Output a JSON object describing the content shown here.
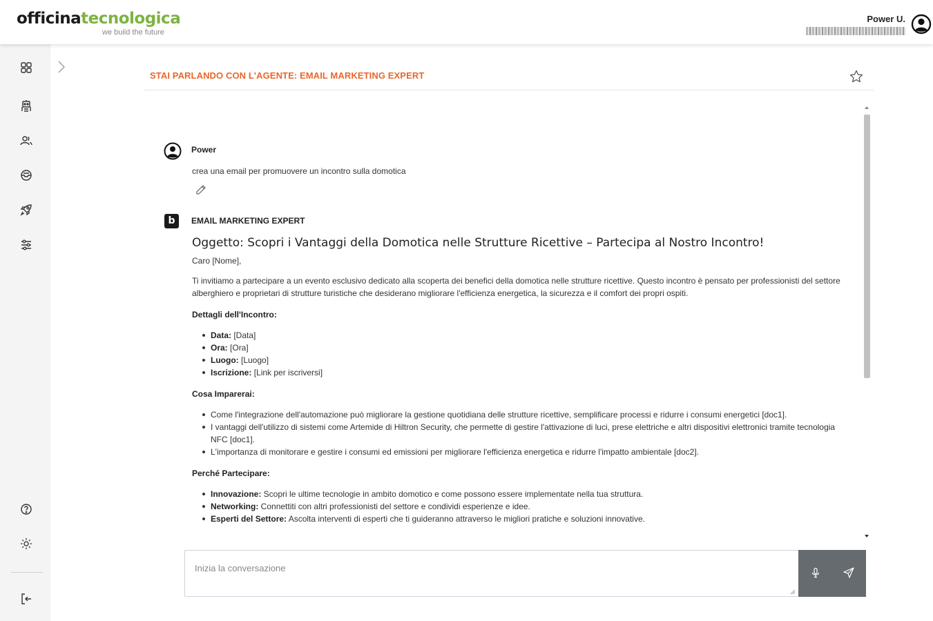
{
  "header": {
    "logo_part1": "offici",
    "logo_part2": "na",
    "logo_part3": "tecnologica",
    "tagline": "we build the future",
    "user_name": "Power U."
  },
  "sidebar": {
    "items": [
      {
        "icon": "dashboard-grid-icon"
      },
      {
        "icon": "robot-icon"
      },
      {
        "icon": "users-icon"
      },
      {
        "icon": "inbox-icon"
      },
      {
        "icon": "rocket-icon"
      },
      {
        "icon": "filters-icon"
      },
      {
        "icon": "help-icon"
      },
      {
        "icon": "brightness-icon"
      },
      {
        "icon": "logout-icon"
      }
    ]
  },
  "agent": {
    "title": "STAI PARLANDO CON L'AGENTE: EMAIL MARKETING EXPERT"
  },
  "chat": {
    "user": {
      "name": "Power",
      "text": "crea una email per promuovere un incontro sulla domotica"
    },
    "bot": {
      "icon_letter": "b",
      "name": "EMAIL MARKETING EXPERT",
      "subject": "Oggetto: Scopri i Vantaggi della Domotica nelle Strutture Ricettive – Partecipa al Nostro Incontro!",
      "greeting": "Caro [Nome],",
      "intro": "Ti invitiamo a partecipare a un evento esclusivo dedicato alla scoperta dei benefici della domotica nelle strutture ricettive. Questo incontro è pensato per professionisti del settore alberghiero e proprietari di strutture turistiche che desiderano migliorare l'efficienza energetica, la sicurezza e il comfort dei propri ospiti.",
      "details_heading": "Dettagli dell'Incontro:",
      "details": [
        {
          "label": "Data:",
          "value": " [Data]"
        },
        {
          "label": "Ora:",
          "value": " [Ora]"
        },
        {
          "label": "Luogo:",
          "value": " [Luogo]"
        },
        {
          "label": "Iscrizione:",
          "value": " [Link per iscriversi]"
        }
      ],
      "learn_heading": "Cosa Imparerai:",
      "learn": [
        "Come l'integrazione dell'automazione può migliorare la gestione quotidiana delle strutture ricettive, semplificare processi e ridurre i consumi energetici [doc1].",
        "I vantaggi dell'utilizzo di sistemi come Artemide di Hiltron Security, che permette di gestire l'attivazione di luci, prese elettriche e altri dispositivi elettronici tramite tecnologia NFC [doc1].",
        "L'importanza di monitorare e gestire i consumi ed emissioni per migliorare l'efficienza energetica e ridurre l'impatto ambientale [doc2]."
      ],
      "why_heading": "Perché Partecipare:",
      "why": [
        {
          "label": "Innovazione:",
          "value": " Scopri le ultime tecnologie in ambito domotico e come possono essere implementate nella tua struttura."
        },
        {
          "label": "Networking:",
          "value": " Connettiti con altri professionisti del settore e condividi esperienze e idee."
        },
        {
          "label": "Esperti del Settore:",
          "value": " Ascolta interventi di esperti che ti guideranno attraverso le migliori pratiche e soluzioni innovative."
        }
      ]
    }
  },
  "composer": {
    "placeholder": "Inizia la conversazione"
  },
  "colors": {
    "accent_orange": "#e8672a",
    "logo_green": "#7cb342",
    "action_bar": "#666b70"
  }
}
